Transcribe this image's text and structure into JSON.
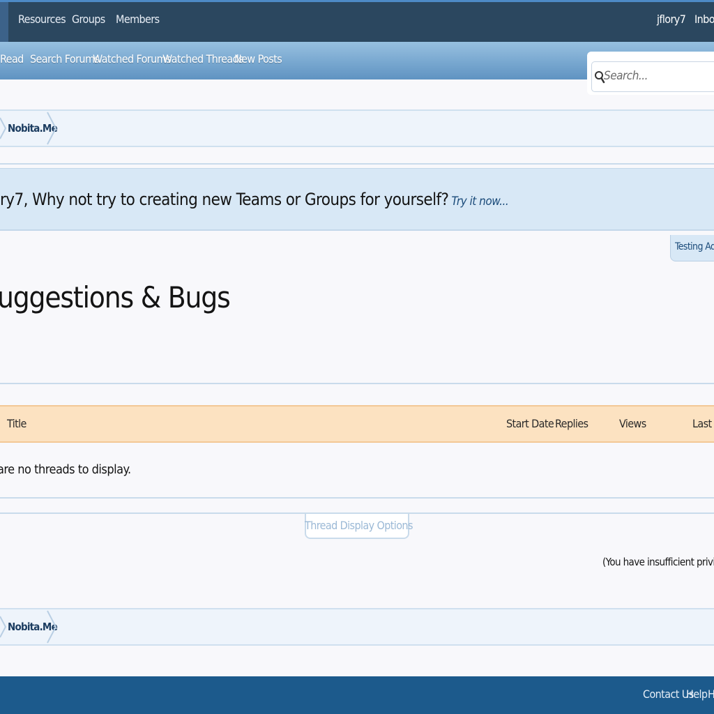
{
  "nav": {
    "tabs": [
      "Resources",
      "Groups",
      "Members"
    ],
    "user": "jflory7",
    "inbox": "Inbox"
  },
  "subnav": {
    "links": [
      "Read",
      "Search Forums",
      "Watched Forums",
      "Watched Threads",
      "New Posts"
    ]
  },
  "search": {
    "placeholder": "Search..."
  },
  "breadcrumb": {
    "top": "Nobita.Me",
    "bottom": "Nobita.Me"
  },
  "notice": {
    "text": "ry7, Why not try to creating new Teams or Groups for yourself?",
    "link": "Try it now..."
  },
  "side_tab": {
    "label": "Testing AddO"
  },
  "page": {
    "title": "uggestions & Bugs"
  },
  "thread_list": {
    "columns": {
      "title": "Title",
      "start_date": "Start Date",
      "replies": "Replies",
      "views": "Views",
      "last": "Last M"
    },
    "empty_message": "are no threads to display."
  },
  "display_options": {
    "label": "Thread Display Options"
  },
  "privileges_note": "(You have insufficient privileges t",
  "footer": {
    "links": [
      "Contact Us",
      "Help",
      "H"
    ]
  },
  "colors": {
    "topbar": "#2b475f",
    "subbar": "#5f93c2",
    "listhead": "#fce2c1",
    "footer": "#1c5a8c",
    "notice": "#d8e8f6"
  }
}
